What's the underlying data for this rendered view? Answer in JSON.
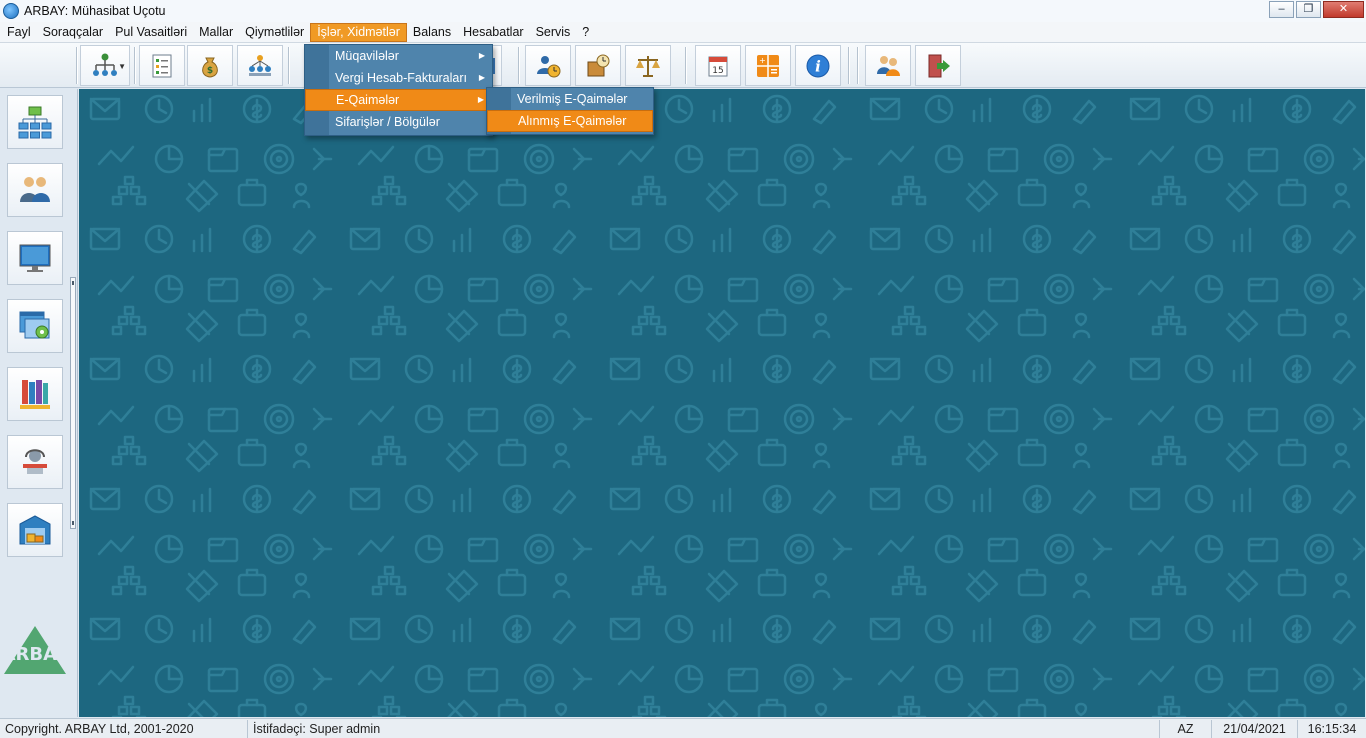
{
  "window": {
    "title": "ARBAY: Mühasibat Uçotu",
    "controls": [
      "minimize-icon",
      "maximize-icon",
      "close-icon"
    ]
  },
  "menubar": [
    {
      "label": "Fayl"
    },
    {
      "label": "Soraqçalar"
    },
    {
      "label": "Pul Vasaitləri"
    },
    {
      "label": "Mallar"
    },
    {
      "label": "Qiymətlilər"
    },
    {
      "label": "İşlər, Xidmətlər",
      "active": true
    },
    {
      "label": "Balans"
    },
    {
      "label": "Hesabatlar"
    },
    {
      "label": "Servis"
    },
    {
      "label": "?"
    }
  ],
  "toolbar_icons": [
    "org-structure-icon",
    "checklist-icon",
    "money-bag-icon",
    "people-network-icon",
    "hidden-icon",
    "customer-history-icon",
    "package-clock-icon",
    "scales-icon",
    "calendar-icon",
    "calculator-icon",
    "info-icon",
    "users-icon",
    "exit-door-icon"
  ],
  "calendar_day": "15",
  "info_glyph": "i",
  "sidebar_icons": [
    "hierarchy-icon",
    "users-icon",
    "monitor-icon",
    "window-settings-icon",
    "books-icon",
    "operator-icon",
    "warehouse-icon"
  ],
  "logo_text": "ARBAY",
  "menu_isler": {
    "items": [
      {
        "label": "Müqavilələr",
        "submenu": true
      },
      {
        "label": "Vergi Hesab-Fakturaları",
        "submenu": true
      },
      {
        "label": "E-Qaimələr",
        "submenu": true,
        "highlighted": true
      },
      {
        "label": "Sifarişlər / Bölgülər",
        "submenu": false
      }
    ]
  },
  "submenu_eqaimeler": {
    "items": [
      {
        "label": "Verilmiş E-Qaimələr"
      },
      {
        "label": "Alınmış E-Qaimələr",
        "highlighted": true
      }
    ]
  },
  "statusbar": {
    "copyright": "Copyright. ARBAY Ltd, 2001-2020",
    "user": "İstifadəçi: Super admin",
    "lang": "AZ",
    "date": "21/04/2021",
    "time": "16:15:34"
  },
  "colors": {
    "accent": "#f08a17",
    "workspace": "#1d6780",
    "menu": "#4f84ac"
  }
}
